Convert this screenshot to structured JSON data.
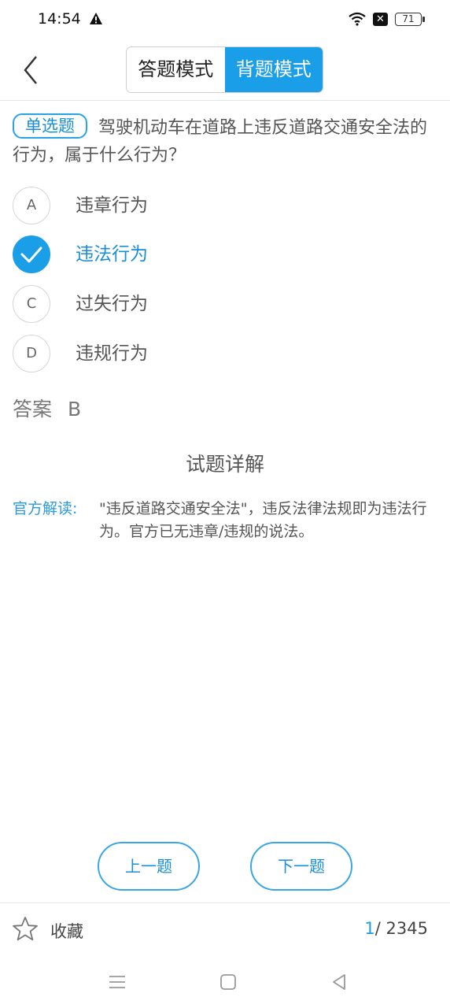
{
  "status_bar": {
    "time": "14:54",
    "battery": "71",
    "icons": [
      "warning-icon",
      "wifi-icon",
      "close-icon",
      "battery-icon"
    ]
  },
  "header": {
    "back_icon": "chevron-left-icon",
    "tabs": [
      {
        "label": "答题模式",
        "active": false
      },
      {
        "label": "背题模式",
        "active": true
      }
    ]
  },
  "question": {
    "type_badge": "单选题",
    "text": "驾驶机动车在道路上违反道路交通安全法的行为，属于什么行为？"
  },
  "options": [
    {
      "letter": "A",
      "text": "违章行为",
      "selected": false
    },
    {
      "letter": "B",
      "text": "违法行为",
      "selected": true
    },
    {
      "letter": "C",
      "text": "过失行为",
      "selected": false
    },
    {
      "letter": "D",
      "text": "违规行为",
      "selected": false
    }
  ],
  "answer": {
    "label": "答案",
    "value": "B"
  },
  "detail": {
    "title": "试题详解",
    "explain_label": "官方解读:",
    "explain_text": "\"违反道路交通安全法\"，违反法律法规即为违法行为。官方已无违章/违规的说法。"
  },
  "navigation": {
    "prev_label": "上一题",
    "next_label": "下一题"
  },
  "bottom_bar": {
    "favorite_label": "收藏",
    "current": "1",
    "separator": "/",
    "total": "2345"
  },
  "colors": {
    "accent": "#1a9ee8",
    "text": "#555555",
    "border": "#d6d6d6"
  }
}
